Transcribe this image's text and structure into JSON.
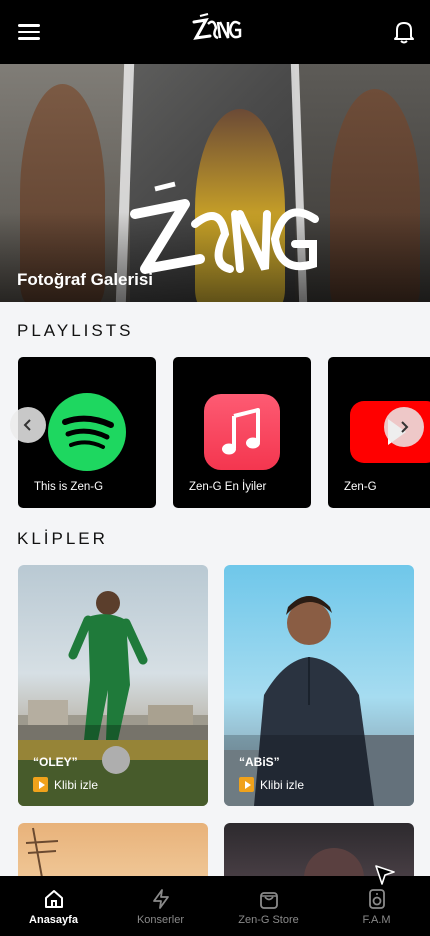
{
  "header": {
    "menu_icon": "hamburger-menu-icon",
    "logo_text": "ZEN-G",
    "bell_icon": "bell-icon"
  },
  "hero": {
    "title": "Fotoğraf Galerisi",
    "graffiti_text": "ZEN-G"
  },
  "playlists": {
    "title": "PLAYLISTS",
    "items": [
      {
        "label": "This is Zen-G",
        "icon": "spotify-icon",
        "color": "#1ed760"
      },
      {
        "label": "Zen-G En İyiler",
        "icon": "apple-music-icon",
        "color": "#fa3e5b"
      },
      {
        "label": "Zen-G",
        "icon": "youtube-icon",
        "color": "#ff0000"
      }
    ],
    "prev_icon": "chevron-left-icon",
    "next_icon": "chevron-right-icon"
  },
  "clips": {
    "title": "KLİPLER",
    "items": [
      {
        "title": "“OLEY”",
        "action": "Klibi izle"
      },
      {
        "title": "“ABiS”",
        "action": "Klibi izle"
      }
    ]
  },
  "bottom_nav": {
    "items": [
      {
        "label": "Anasayfa",
        "icon": "home-icon",
        "active": true
      },
      {
        "label": "Konserler",
        "icon": "lightning-icon",
        "active": false
      },
      {
        "label": "Zen-G Store",
        "icon": "shopping-bag-icon",
        "active": false
      },
      {
        "label": "F.A.M",
        "icon": "speaker-icon",
        "active": false
      }
    ]
  },
  "colors": {
    "header_bg": "#000000",
    "page_bg": "#f4f5f7",
    "accent_play": "#f0a21b"
  }
}
